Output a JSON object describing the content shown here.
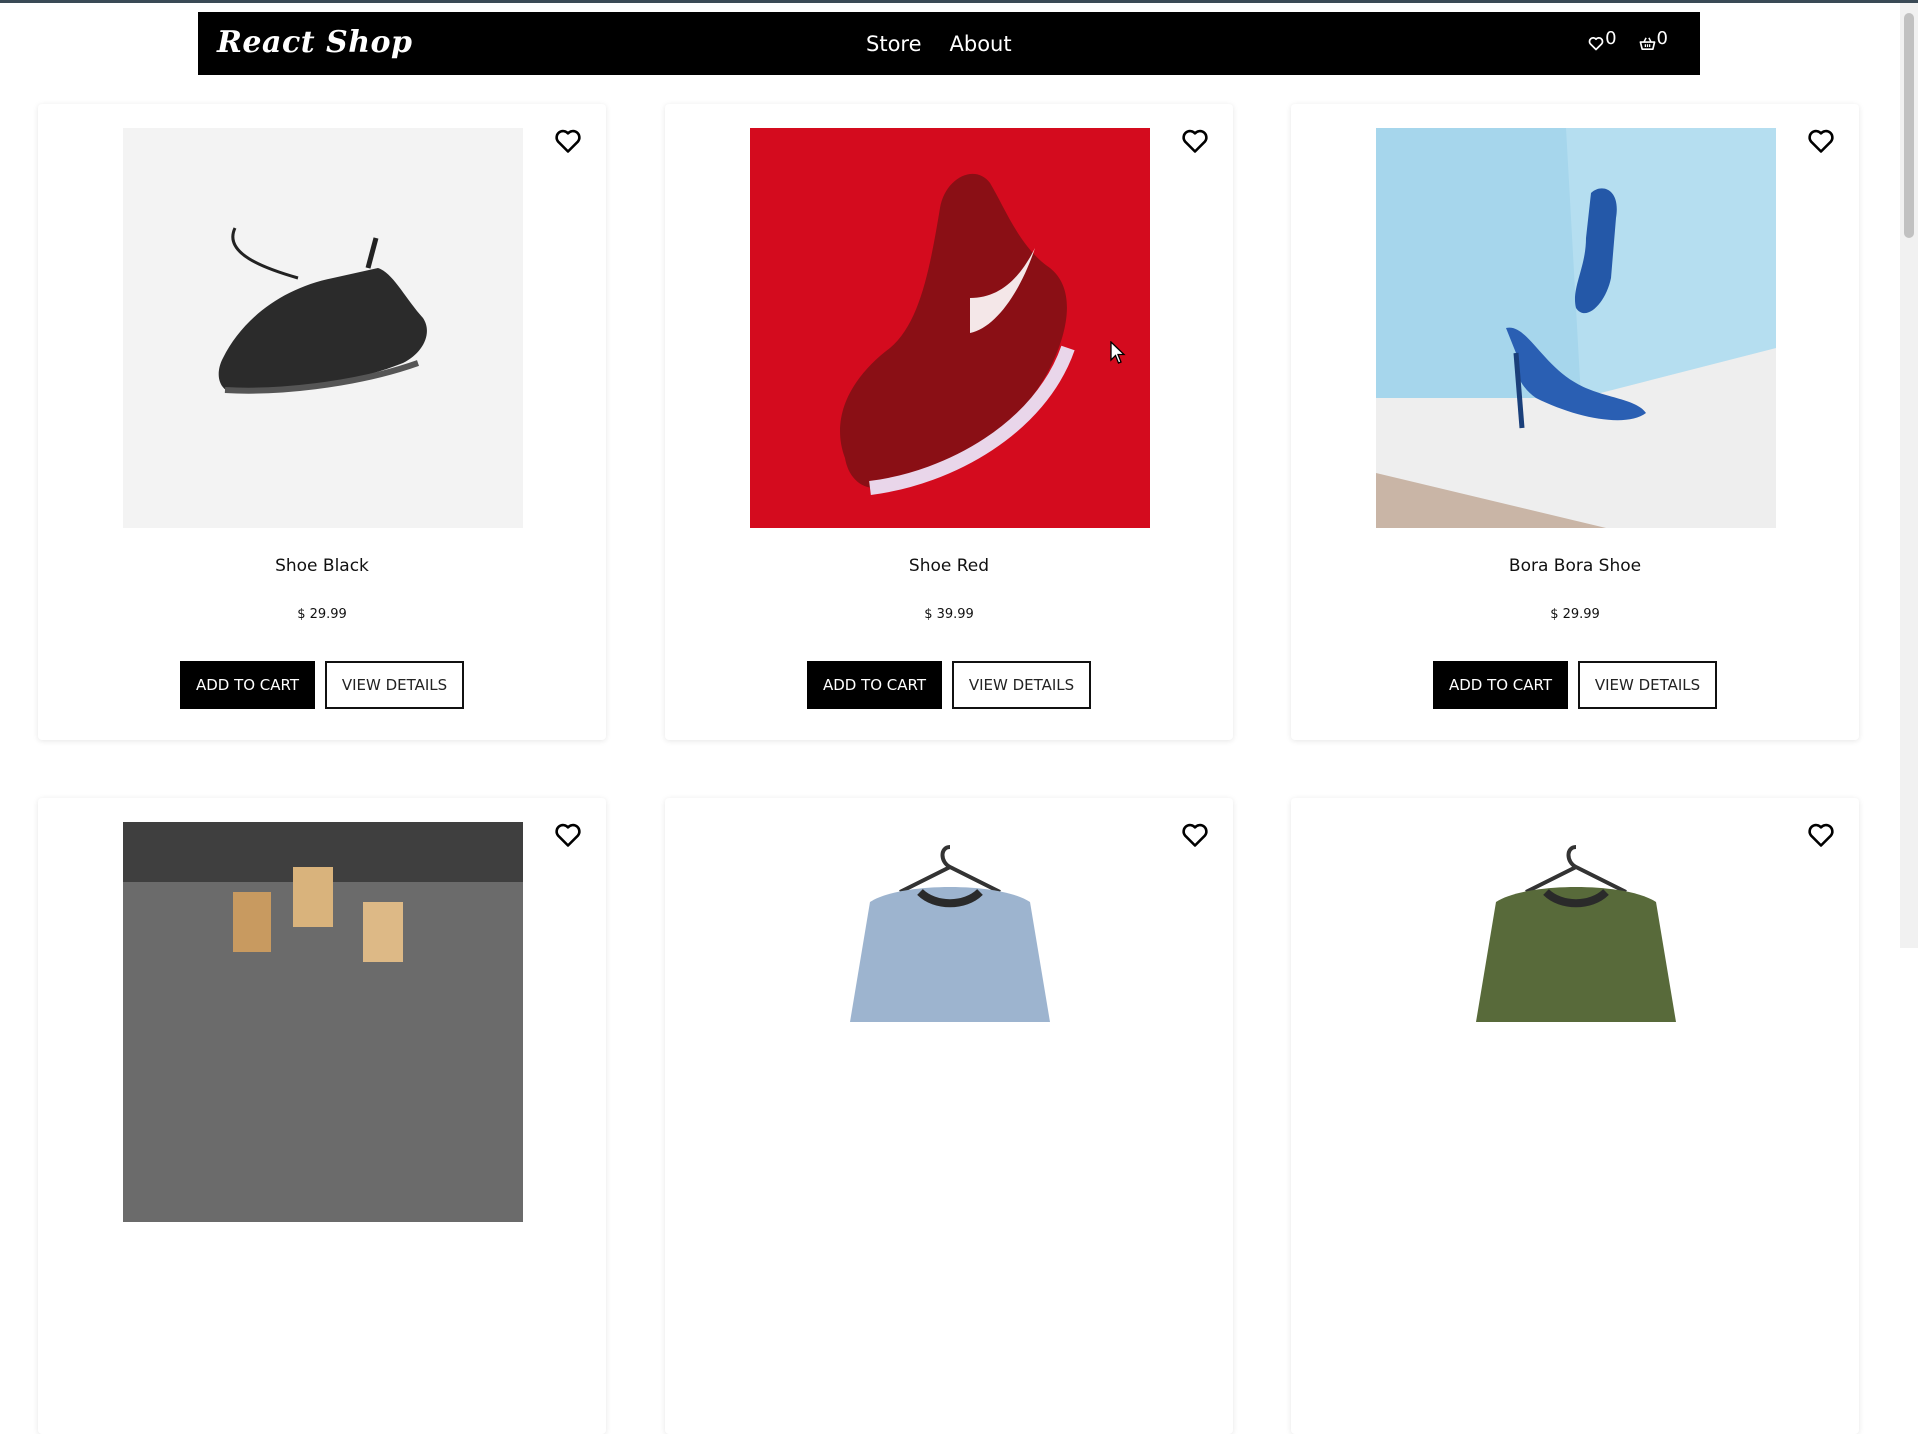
{
  "nav": {
    "brand": "React Shop",
    "links": [
      "Store",
      "About"
    ],
    "wishlist_count": "0",
    "cart_count": "0",
    "icons": [
      "heart-icon",
      "basket-icon"
    ]
  },
  "products": [
    {
      "name": "Shoe Black",
      "price": "$ 29.99",
      "add_label": "ADD TO CART",
      "view_label": "VIEW DETAILS"
    },
    {
      "name": "Shoe Red",
      "price": "$ 39.99",
      "add_label": "ADD TO CART",
      "view_label": "VIEW DETAILS"
    },
    {
      "name": "Bora Bora Shoe",
      "price": "$ 29.99",
      "add_label": "ADD TO CART",
      "view_label": "VIEW DETAILS"
    }
  ],
  "colors": {
    "navbar_bg": "#000000",
    "button_bg": "#000000",
    "page_bg": "#ffffff"
  }
}
